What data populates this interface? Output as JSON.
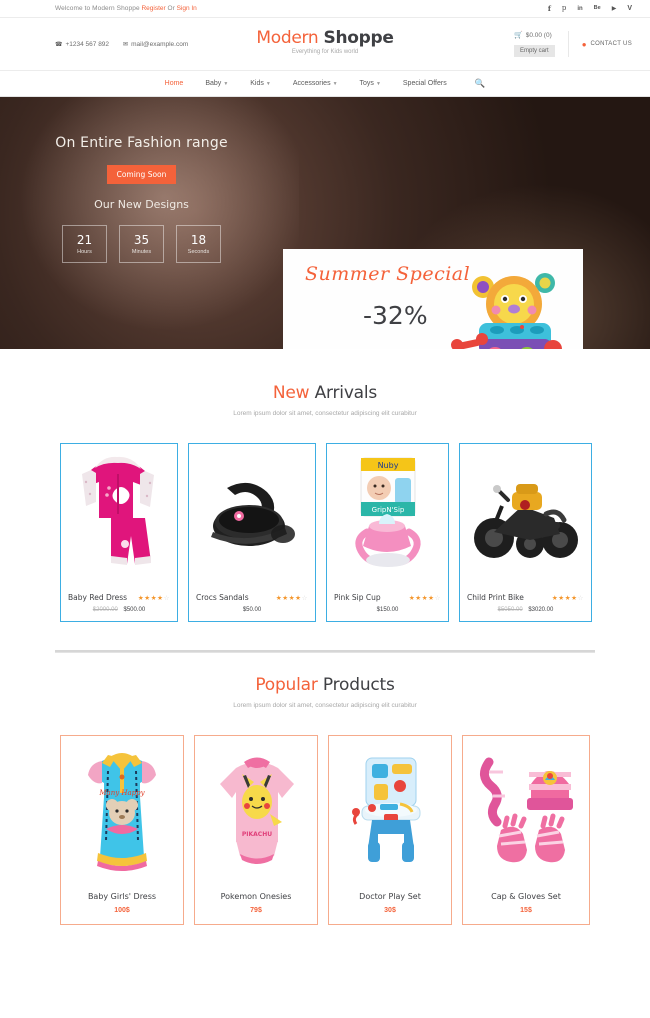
{
  "topbar": {
    "welcome": "Welcome to Modern Shoppe",
    "register": "Register",
    "or": "Or",
    "signin": "Sign In",
    "social": [
      {
        "name": "facebook-icon",
        "glyph": "f"
      },
      {
        "name": "pinterest-icon",
        "glyph": "p"
      },
      {
        "name": "linkedin-icon",
        "glyph": "in"
      },
      {
        "name": "behance-icon",
        "glyph": "Be"
      },
      {
        "name": "youtube-icon",
        "glyph": "▶"
      },
      {
        "name": "vimeo-icon",
        "glyph": "V"
      }
    ]
  },
  "header": {
    "phone": "+1234 567 892",
    "email": "mail@example.com",
    "logo_first": "Modern",
    "logo_second": "Shoppe",
    "tagline": "Everything for Kids world",
    "cart_total": "$0.00 (0)",
    "empty_cart": "Empty cart",
    "contact_us": "CONTACT US"
  },
  "nav": {
    "items": [
      {
        "label": "Home",
        "active": true,
        "caret": false
      },
      {
        "label": "Baby",
        "active": false,
        "caret": true
      },
      {
        "label": "Kids",
        "active": false,
        "caret": true
      },
      {
        "label": "Accessories",
        "active": false,
        "caret": true
      },
      {
        "label": "Toys",
        "active": false,
        "caret": true
      },
      {
        "label": "Special Offers",
        "active": false,
        "caret": false
      }
    ]
  },
  "hero": {
    "headline": "On Entire Fashion range",
    "button": "Coming Soon",
    "subline": "Our New Designs",
    "timer": [
      {
        "value": "21",
        "label": "Hours"
      },
      {
        "value": "35",
        "label": "Minutes"
      },
      {
        "value": "18",
        "label": "Seconds"
      }
    ],
    "promo_title": "Summer Special",
    "promo_discount": "-32%",
    "dots_active_index": 2,
    "dots_count": 3
  },
  "new_arrivals": {
    "title_first": "New",
    "title_second": "Arrivals",
    "subtitle": "Lorem ipsum dolor sit amet, consectetur adipiscing elit curabitur",
    "products": [
      {
        "name": "Baby Red Dress",
        "rating": 4,
        "old_price": "$2000.00",
        "price": "$500.00"
      },
      {
        "name": "Crocs Sandals",
        "rating": 4,
        "old_price": "",
        "price": "$50.00"
      },
      {
        "name": "Pink Sip Cup",
        "rating": 4,
        "old_price": "",
        "price": "$150.00"
      },
      {
        "name": "Child Print Bike",
        "rating": 4,
        "old_price": "$5050.00",
        "price": "$3020.00"
      }
    ]
  },
  "popular_products": {
    "title_first": "Popular",
    "title_second": "Products",
    "subtitle": "Lorem ipsum dolor sit amet, consectetur adipiscing elit curabitur",
    "products": [
      {
        "name": "Baby Girls' Dress",
        "price": "100$"
      },
      {
        "name": "Pokemon Onesies",
        "price": "79$"
      },
      {
        "name": "Doctor Play Set",
        "price": "30$"
      },
      {
        "name": "Cap & Gloves Set",
        "price": "15$"
      }
    ]
  },
  "colors": {
    "accent": "#f4623a",
    "dark": "#3f4044",
    "new_border": "#3daee3",
    "popular_border": "#f6ab8c",
    "star": "#f4952a"
  }
}
